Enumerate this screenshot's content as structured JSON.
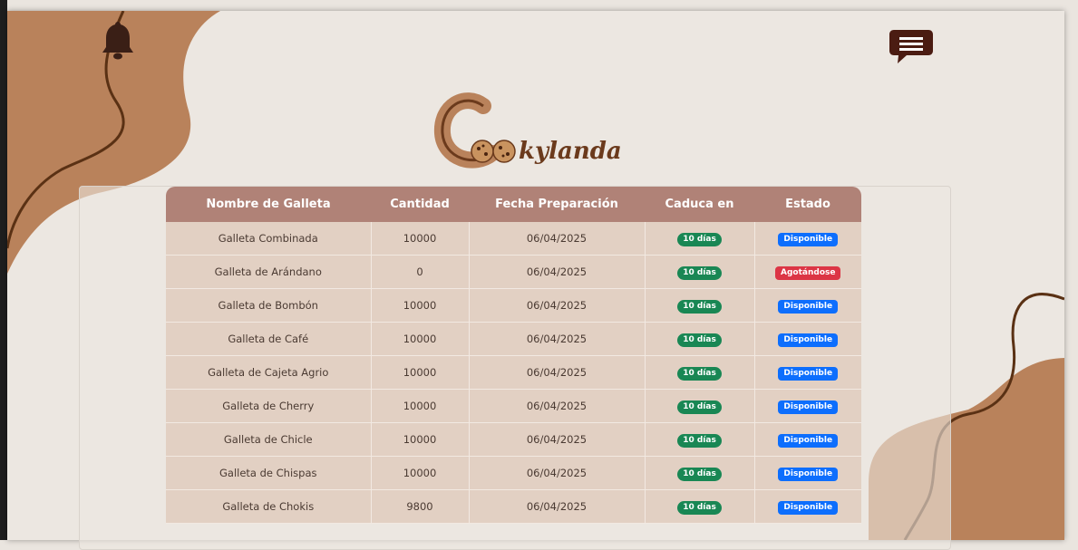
{
  "brand": {
    "name": "Cookylanda"
  },
  "icons": {
    "notifications": "bell-icon",
    "menu": "chat-menu-icon"
  },
  "colors": {
    "header_bg": "#b08277",
    "row_bg": "#e2d0c3",
    "expiry_badge": "#198754",
    "available_badge": "#0d6efd",
    "low_badge": "#dc3545",
    "decor": "#b9825b"
  },
  "table": {
    "headers": [
      "Nombre de Galleta",
      "Cantidad",
      "Fecha Preparación",
      "Caduca en",
      "Estado"
    ],
    "rows": [
      {
        "name": "Galleta Combinada",
        "qty": "10000",
        "date": "06/04/2025",
        "expires": "10 días",
        "status": "Disponible",
        "status_type": "available"
      },
      {
        "name": "Galleta de Arándano",
        "qty": "0",
        "date": "06/04/2025",
        "expires": "10 días",
        "status": "Agotándose",
        "status_type": "low"
      },
      {
        "name": "Galleta de Bombón",
        "qty": "10000",
        "date": "06/04/2025",
        "expires": "10 días",
        "status": "Disponible",
        "status_type": "available"
      },
      {
        "name": "Galleta de Café",
        "qty": "10000",
        "date": "06/04/2025",
        "expires": "10 días",
        "status": "Disponible",
        "status_type": "available"
      },
      {
        "name": "Galleta de Cajeta Agrio",
        "qty": "10000",
        "date": "06/04/2025",
        "expires": "10 días",
        "status": "Disponible",
        "status_type": "available"
      },
      {
        "name": "Galleta de Cherry",
        "qty": "10000",
        "date": "06/04/2025",
        "expires": "10 días",
        "status": "Disponible",
        "status_type": "available"
      },
      {
        "name": "Galleta de Chicle",
        "qty": "10000",
        "date": "06/04/2025",
        "expires": "10 días",
        "status": "Disponible",
        "status_type": "available"
      },
      {
        "name": "Galleta de Chispas",
        "qty": "10000",
        "date": "06/04/2025",
        "expires": "10 días",
        "status": "Disponible",
        "status_type": "available"
      },
      {
        "name": "Galleta de Chokis",
        "qty": "9800",
        "date": "06/04/2025",
        "expires": "10 días",
        "status": "Disponible",
        "status_type": "available"
      }
    ]
  }
}
